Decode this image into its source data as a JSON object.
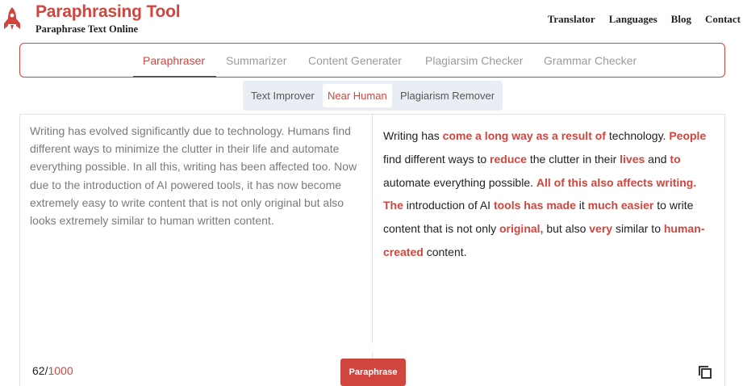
{
  "brand": {
    "title": "Paraphrasing Tool",
    "subtitle": "Paraphrase Text Online",
    "logo_icon": "rocket-icon",
    "accent": "#d0463f"
  },
  "topnav": [
    "Translator",
    "Languages",
    "Blog",
    "Contact"
  ],
  "tools": {
    "tabs": [
      "Paraphraser",
      "Summarizer",
      "Content Generater",
      "Plagiarsim Checker",
      "Grammar Checker"
    ],
    "active": "Paraphraser"
  },
  "modes": {
    "items": [
      "Text Improver",
      "Near Human",
      "Plagiarism Remover"
    ],
    "active": "Near Human"
  },
  "input": {
    "text": "Writing has evolved significantly due to technology. Humans find different ways to minimize the clutter in their life and automate everything possible. In all this, writing has been affected too. Now due to the introduction of AI powered tools, it has now become extremely easy to write content that is not only original but also looks extremely similar to human written content."
  },
  "output": {
    "segments": [
      {
        "text": "Writing has ",
        "changed": false
      },
      {
        "text": "come a long way as a result of",
        "changed": true
      },
      {
        "text": " technology. ",
        "changed": false
      },
      {
        "text": "People",
        "changed": true
      },
      {
        "text": " find different ways to ",
        "changed": false
      },
      {
        "text": "reduce",
        "changed": true
      },
      {
        "text": " the clutter in their ",
        "changed": false
      },
      {
        "text": "lives",
        "changed": true
      },
      {
        "text": " and ",
        "changed": false
      },
      {
        "text": "to",
        "changed": true
      },
      {
        "text": " automate everything possible. ",
        "changed": false
      },
      {
        "text": "All of this also affects writing. The",
        "changed": true
      },
      {
        "text": " introduction of AI ",
        "changed": false
      },
      {
        "text": "tools has made",
        "changed": true
      },
      {
        "text": " it ",
        "changed": false
      },
      {
        "text": "much easier",
        "changed": true
      },
      {
        "text": " to write content that is not only ",
        "changed": false
      },
      {
        "text": "original,",
        "changed": true
      },
      {
        "text": " but also ",
        "changed": false
      },
      {
        "text": "very",
        "changed": true
      },
      {
        "text": " similar to ",
        "changed": false
      },
      {
        "text": "human-created",
        "changed": true
      },
      {
        "text": " content.",
        "changed": false
      }
    ]
  },
  "counter": {
    "count": "62",
    "separator": "/",
    "max": "1000"
  },
  "actions": {
    "paraphrase_label": "Paraphrase",
    "copy_icon": "copy-icon"
  }
}
